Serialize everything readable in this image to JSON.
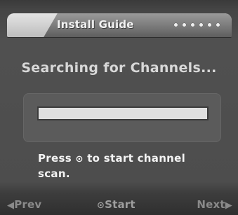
{
  "header": {
    "title": "Install Guide",
    "step_indicator_count": 6
  },
  "status_text": "Searching for Channels...",
  "progress": {
    "fraction": 1.0
  },
  "instruction": {
    "prefix": "Press",
    "ok_icon_glyph": "⊙",
    "suffix": "to start channel scan."
  },
  "footer": {
    "prev_icon": "◀",
    "prev_label": "Prev",
    "start_icon": "⊙",
    "start_label": "Start",
    "next_label": "Next",
    "next_icon": "▶"
  },
  "icons": {
    "prev": "left-triangle-icon",
    "start": "ok-button-icon",
    "next": "right-triangle-icon",
    "instruction": "ok-button-icon"
  }
}
